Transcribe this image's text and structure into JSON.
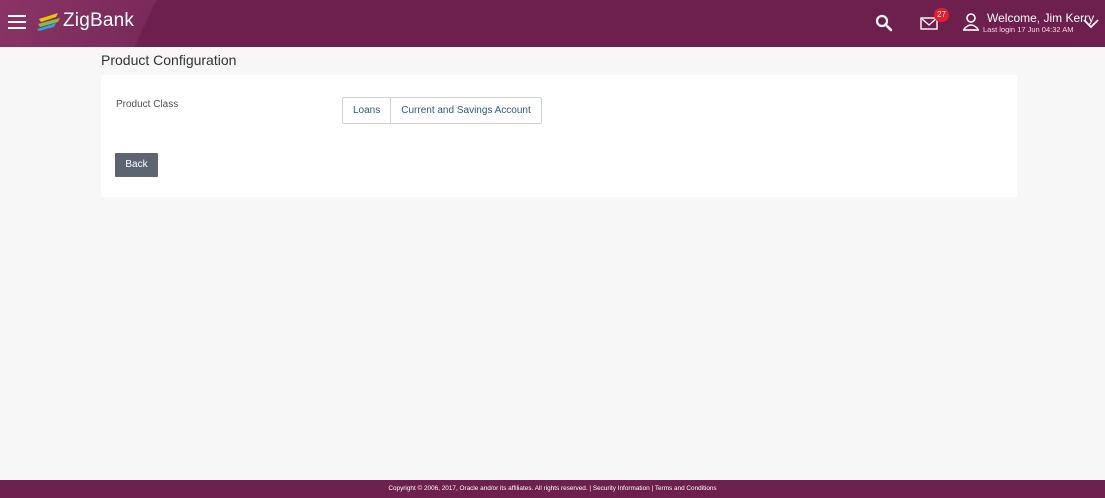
{
  "header": {
    "brand": "ZigBank",
    "notification_count": "27",
    "welcome": "Welcome, Jim Kerry",
    "last_login": "Last login 17 Jun 04:32 AM",
    "colors": {
      "bar": "#6d1f4e",
      "badge": "#e51f2a"
    },
    "icons": [
      "menu-icon",
      "zigbank-logo-icon",
      "search-icon",
      "mail-icon",
      "user-icon",
      "chevron-down-icon"
    ]
  },
  "page": {
    "title": "Product Configuration"
  },
  "form": {
    "product_class_label": "Product Class",
    "options": [
      "Loans",
      "Current and Savings Account"
    ],
    "back_label": "Back"
  },
  "footer": {
    "copyright": "Copyright © 2006, 2017, Oracle and/or its affiliates. All rights reserved.",
    "sep1": " | ",
    "security_link": "Security Information",
    "sep2": " | ",
    "terms_link": "Terms and Conditions"
  }
}
